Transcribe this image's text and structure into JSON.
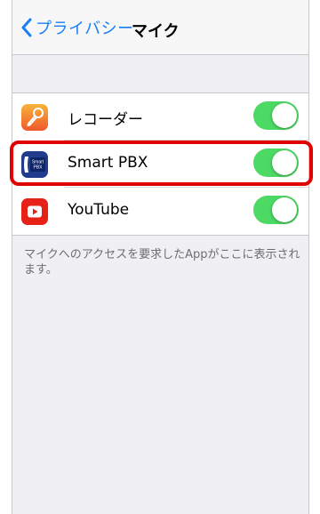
{
  "nav": {
    "back_label": "プライバシー",
    "title": "マイク"
  },
  "apps": [
    {
      "name": "レコーダー",
      "icon": "recorder-icon",
      "enabled": true
    },
    {
      "name": "Smart PBX",
      "icon": "smart-pbx-icon",
      "icon_text_top": "Smart",
      "icon_text_bottom": "PBX",
      "enabled": true
    },
    {
      "name": "YouTube",
      "icon": "youtube-icon",
      "enabled": true
    }
  ],
  "footer_note": "マイクへのアクセスを要求したAppがここに表示されます。",
  "colors": {
    "tint": "#1a7ef5",
    "switch_on": "#4cd964",
    "highlight": "#e00000",
    "background": "#efeff4"
  }
}
